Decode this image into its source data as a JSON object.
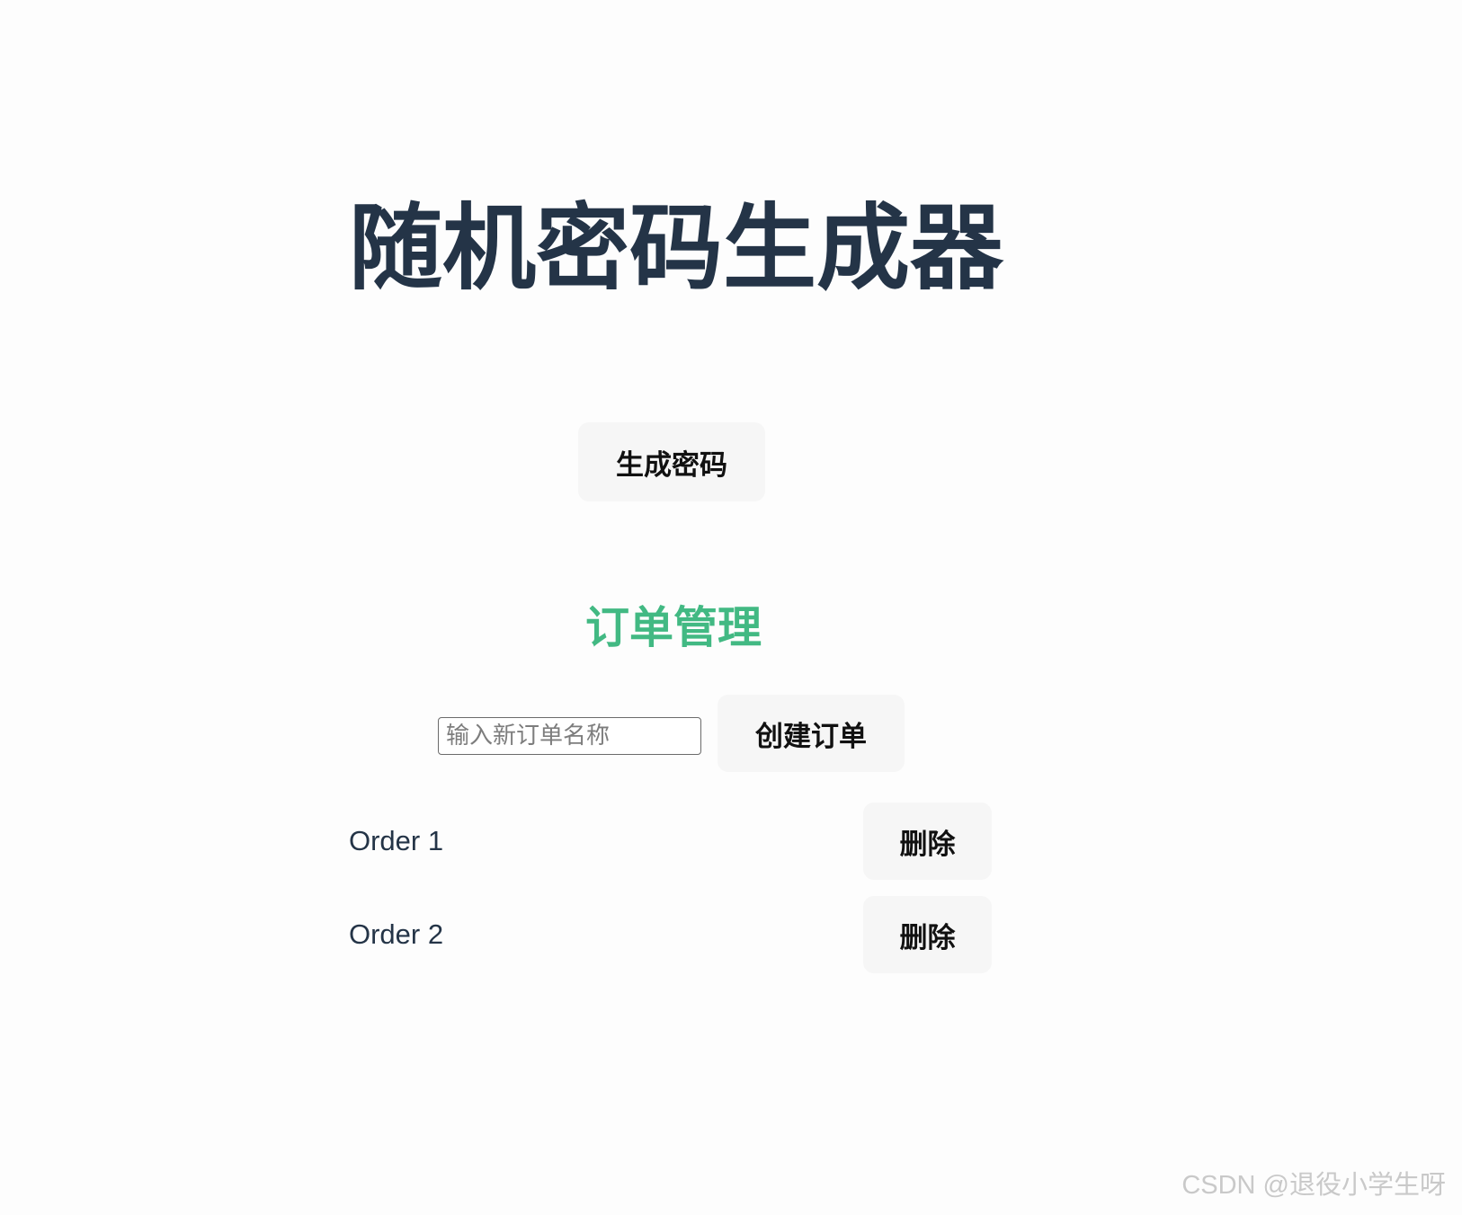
{
  "page": {
    "title": "随机密码生成器",
    "generate_button": "生成密码"
  },
  "orders": {
    "title": "订单管理",
    "input": {
      "placeholder": "输入新订单名称",
      "value": ""
    },
    "create_button": "创建订单",
    "items": [
      {
        "name": "Order 1",
        "delete_label": "删除"
      },
      {
        "name": "Order 2",
        "delete_label": "删除"
      }
    ]
  },
  "watermark": "CSDN @退役小学生呀",
  "colors": {
    "title": "#243447",
    "accent": "#42b983",
    "button_bg": "#f6f6f6",
    "background": "#fdfdfd"
  }
}
